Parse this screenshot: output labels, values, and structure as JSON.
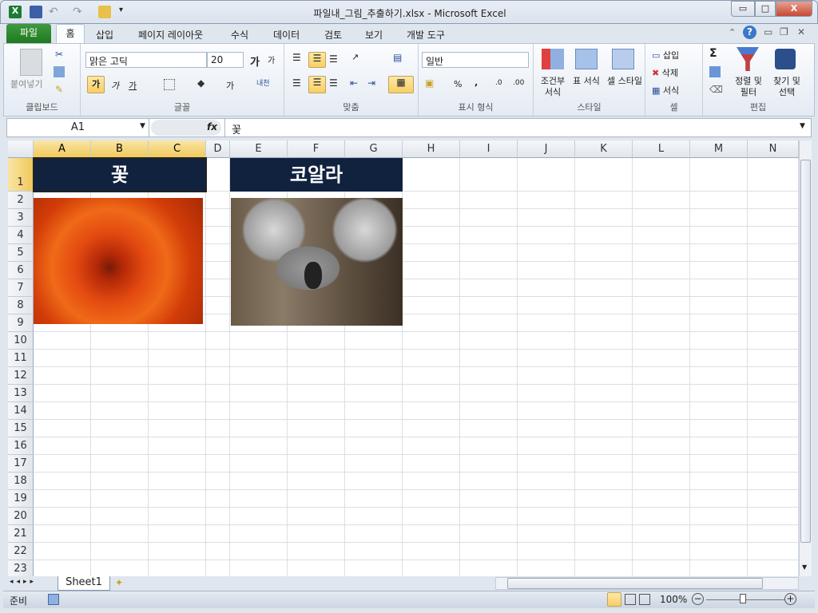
{
  "window": {
    "title": "파일내_그림_추출하기.xlsx - Microsoft Excel",
    "minimize": "▭",
    "restore": "□",
    "close": "X"
  },
  "tabs": {
    "file": "파일",
    "items": [
      "홈",
      "삽입",
      "페이지 레이아웃",
      "수식",
      "데이터",
      "검토",
      "보기",
      "개발 도구"
    ]
  },
  "ribbon": {
    "clipboard": {
      "paste": "붙여넣기",
      "label": "클립보드"
    },
    "font": {
      "name": "맑은 고딕",
      "size": "20",
      "bold": "가",
      "italic": "가",
      "underline": "가",
      "fontcolor": "가",
      "phonetic": "내천",
      "label": "글꼴"
    },
    "align": {
      "label": "맞춤"
    },
    "number": {
      "format": "일반",
      "percent": "%",
      "comma": ",",
      "label": "표시 형식"
    },
    "styles": {
      "cond": "조건부 서식",
      "table": "표 서식",
      "cell": "셀 스타일",
      "label": "스타일"
    },
    "cells": {
      "insert": "삽입",
      "delete": "삭제",
      "format": "서식",
      "label": "셀"
    },
    "edit": {
      "sum": "Σ",
      "sort": "정렬 및 필터",
      "find": "찾기 및 선택",
      "label": "편집"
    }
  },
  "formula": {
    "namebox": "A1",
    "fx": "fx",
    "value": "꽃"
  },
  "columns": [
    "A",
    "B",
    "C",
    "D",
    "E",
    "F",
    "G",
    "H",
    "I",
    "J",
    "K",
    "L",
    "M",
    "N"
  ],
  "rows": 23,
  "selected": {
    "cell": "A1",
    "cols": [
      "A",
      "B",
      "C"
    ],
    "row": 1
  },
  "cells": {
    "A1": "꽃",
    "E1": "코알라"
  },
  "pictures": [
    "flower",
    "koala"
  ],
  "sheets": [
    "Sheet1"
  ],
  "status": {
    "ready": "준비",
    "zoom": "100%"
  },
  "colors": {
    "header_fill": "#10223e",
    "header_text": "#ffffff",
    "file_tab": "#2a8a2a"
  }
}
